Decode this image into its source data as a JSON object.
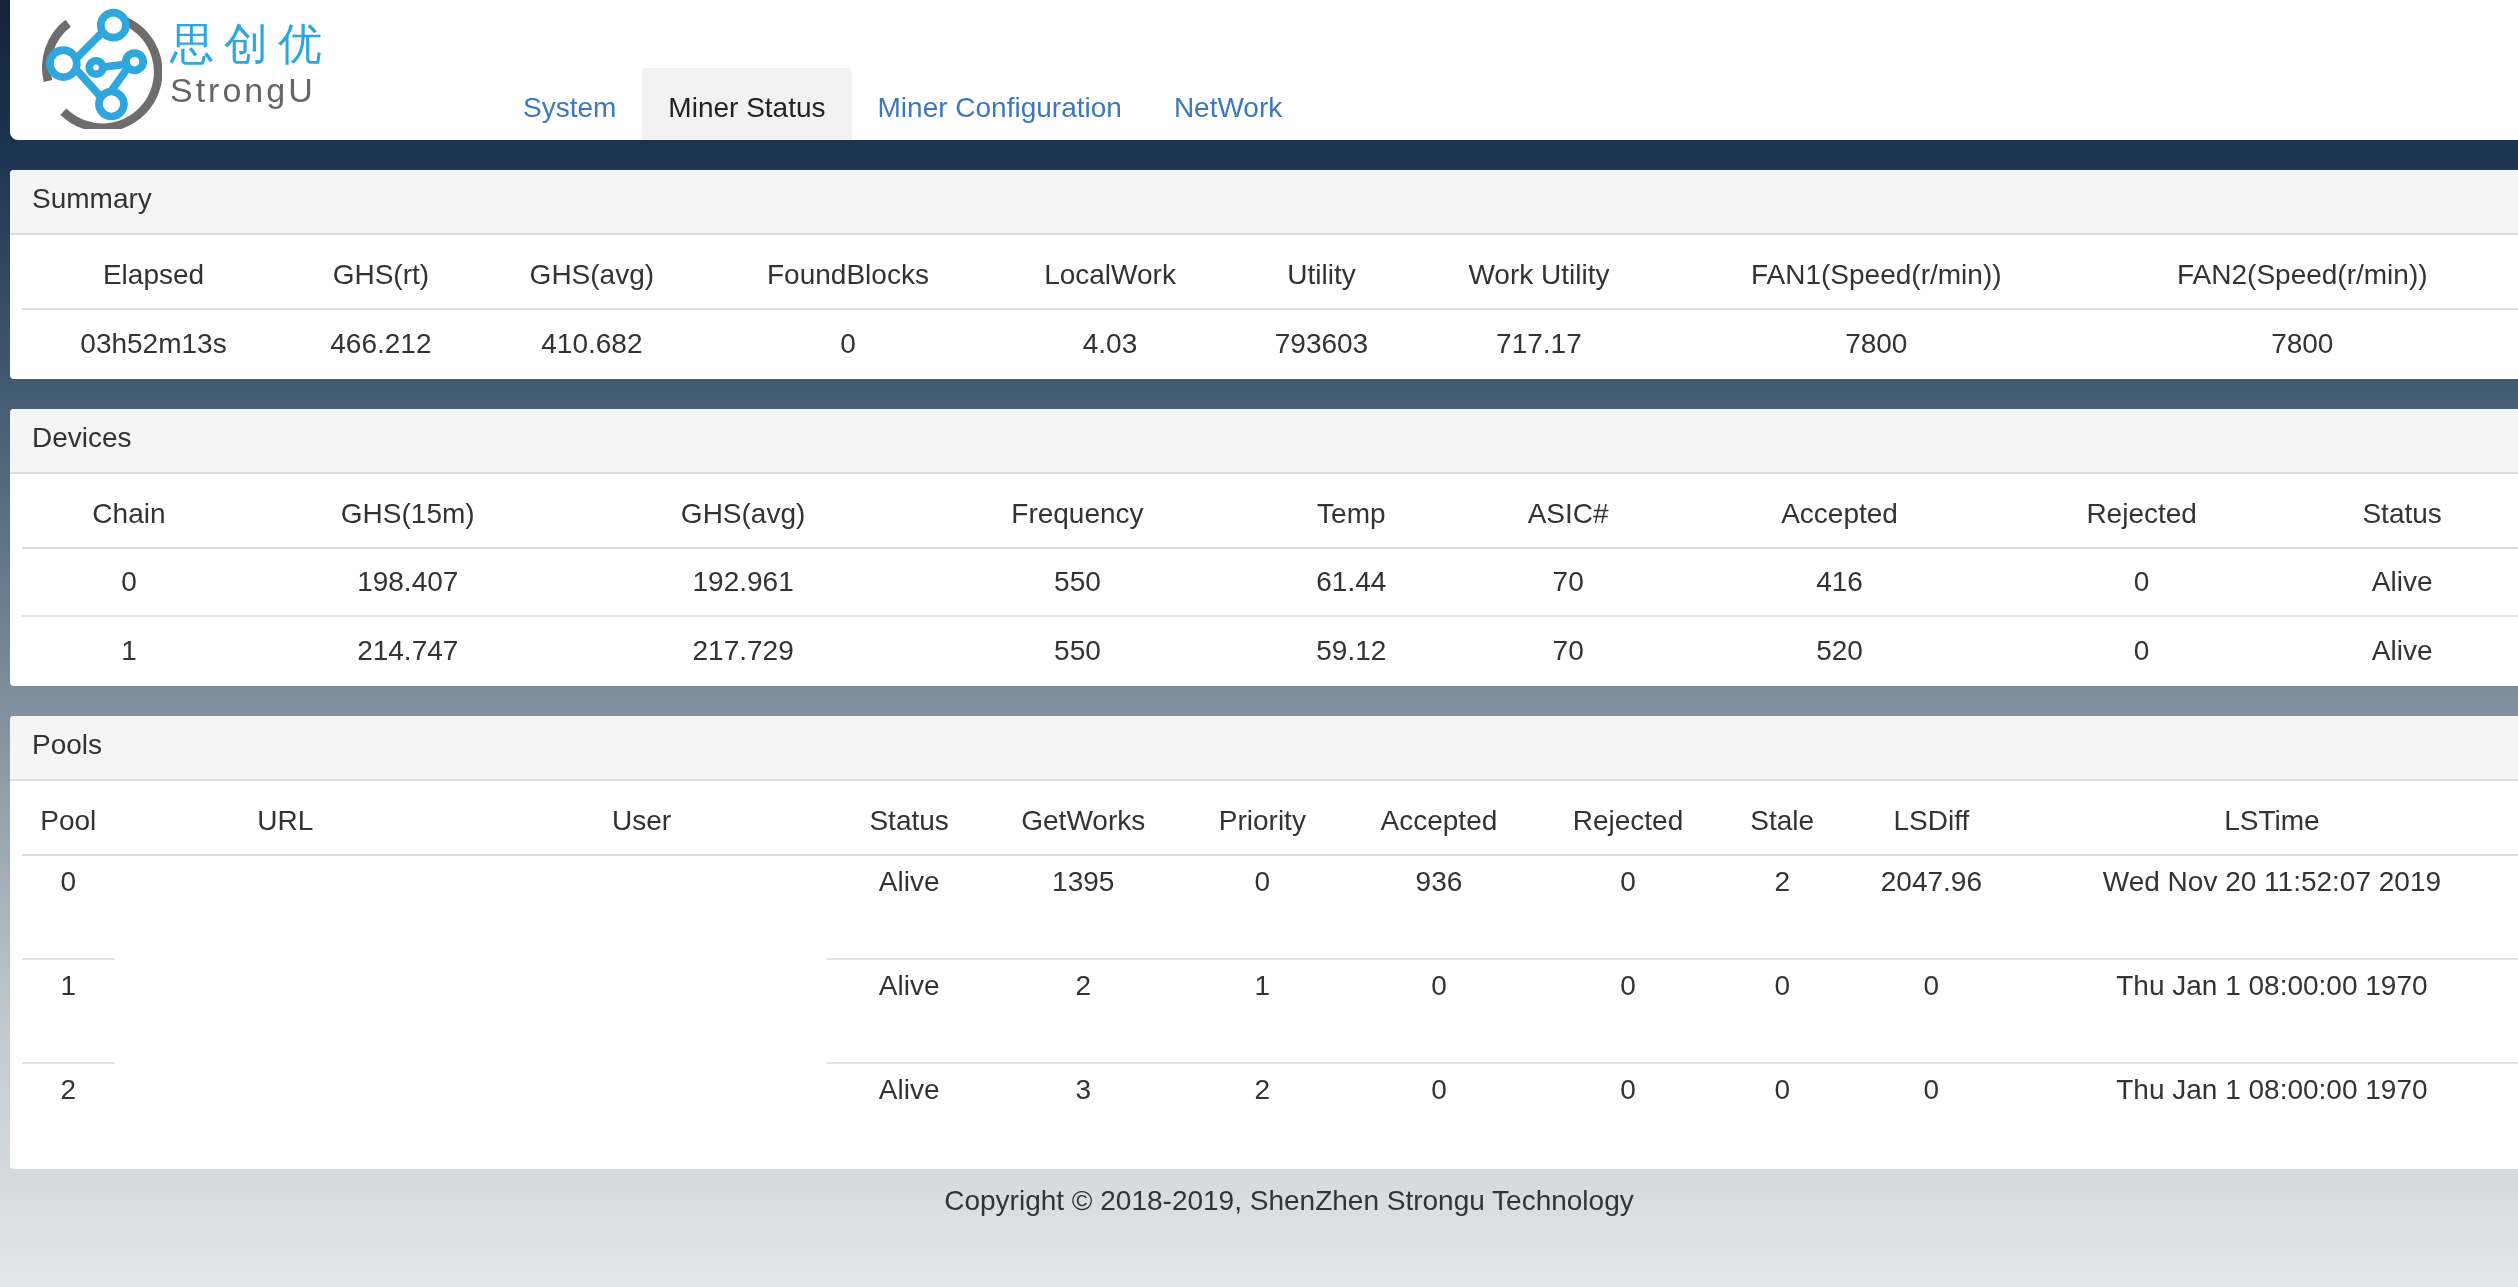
{
  "logo": {
    "name_cn": "思创优",
    "name_en": "StrongU"
  },
  "tabs": [
    {
      "label": "System",
      "selected": false
    },
    {
      "label": "Miner Status",
      "selected": true
    },
    {
      "label": "Miner Configuration",
      "selected": false
    },
    {
      "label": "NetWork",
      "selected": false
    }
  ],
  "summary": {
    "title": "Summary",
    "columns": [
      "Elapsed",
      "GHS(rt)",
      "GHS(avg)",
      "FoundBlocks",
      "LocalWork",
      "Utility",
      "Work Utility",
      "FAN1(Speed(r/min))",
      "FAN2(Speed(r/min))"
    ],
    "rows": [
      [
        "03h52m13s",
        "466.212",
        "410.682",
        "0",
        "4.03",
        "793603",
        "717.17",
        "7800",
        "7800"
      ]
    ]
  },
  "devices": {
    "title": "Devices",
    "columns": [
      "Chain",
      "GHS(15m)",
      "GHS(avg)",
      "Frequency",
      "Temp",
      "ASIC#",
      "Accepted",
      "Rejected",
      "Status"
    ],
    "rows": [
      [
        "0",
        "198.407",
        "192.961",
        "550",
        "61.44",
        "70",
        "416",
        "0",
        "Alive"
      ],
      [
        "1",
        "214.747",
        "217.729",
        "550",
        "59.12",
        "70",
        "520",
        "0",
        "Alive"
      ]
    ]
  },
  "pools": {
    "title": "Pools",
    "columns": [
      "Pool",
      "URL",
      "User",
      "Status",
      "GetWorks",
      "Priority",
      "Accepted",
      "Rejected",
      "Stale",
      "LSDiff",
      "LSTime"
    ],
    "rows": [
      [
        "0",
        "",
        "",
        "Alive",
        "1395",
        "0",
        "936",
        "0",
        "2",
        "2047.96",
        "Wed Nov 20 11:52:07 2019"
      ],
      [
        "1",
        "",
        "",
        "Alive",
        "2",
        "1",
        "0",
        "0",
        "0",
        "0",
        "Thu Jan 1 08:00:00 1970"
      ],
      [
        "2",
        "",
        "",
        "Alive",
        "3",
        "2",
        "0",
        "0",
        "0",
        "0",
        "Thu Jan 1 08:00:00 1970"
      ]
    ]
  },
  "footer": "Copyright © 2018-2019, ShenZhen Strongu Technology"
}
